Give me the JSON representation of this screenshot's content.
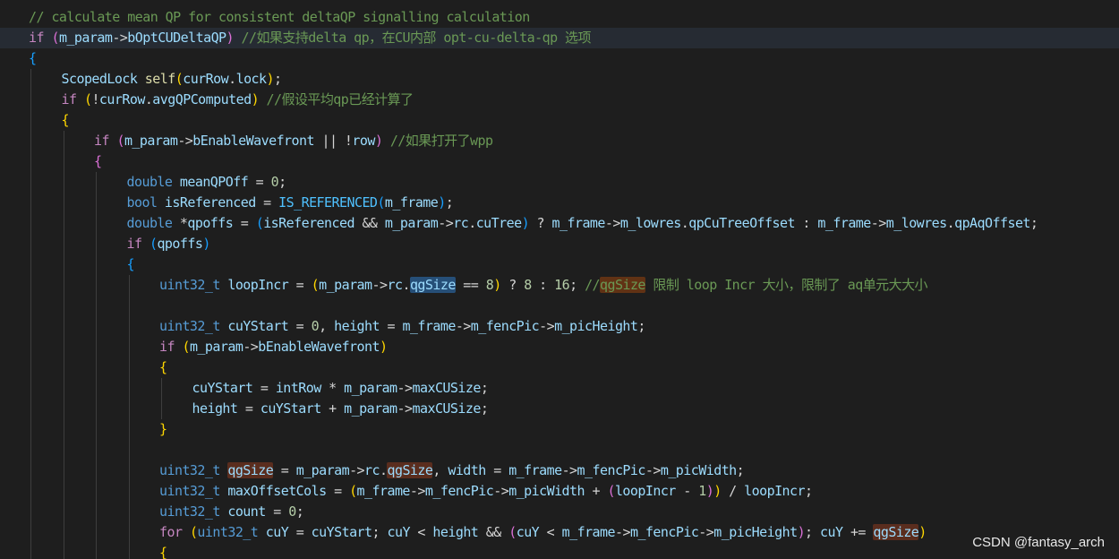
{
  "colors": {
    "background": "#1e1e1e",
    "current_line": "#262b33",
    "comment": "#6a9955",
    "keyword": "#c586c0",
    "type": "#569cd6",
    "function": "#dcdcaa",
    "variable": "#9cdcfe",
    "number": "#b5cea8",
    "bracket_level_1": "#ffd700",
    "bracket_level_2": "#da70d6",
    "bracket_level_3": "#179fff",
    "selection": "#264f78",
    "word_highlight": "#5a2d1e"
  },
  "editor": {
    "lines": [
      {
        "indent": 0,
        "tokens": [
          {
            "t": "// calculate mean QP for consistent deltaQP signalling calculation",
            "c": "cm"
          }
        ]
      },
      {
        "indent": 0,
        "current": true,
        "tokens": [
          {
            "t": "if",
            "c": "kw"
          },
          {
            "t": " ",
            "c": "pl"
          },
          {
            "t": "(",
            "c": "b2"
          },
          {
            "t": "m_param",
            "c": "var"
          },
          {
            "t": "->",
            "c": "op"
          },
          {
            "t": "bOptCUDeltaQP",
            "c": "var"
          },
          {
            "t": ")",
            "c": "b2"
          },
          {
            "t": " ",
            "c": "pl"
          },
          {
            "t": "//如果支持delta qp，在CU内部 opt-cu-delta-qp 选项",
            "c": "cm"
          }
        ]
      },
      {
        "indent": 0,
        "tokens": [
          {
            "t": "{",
            "c": "b3"
          }
        ]
      },
      {
        "indent": 1,
        "tokens": [
          {
            "t": "ScopedLock",
            "c": "var"
          },
          {
            "t": " ",
            "c": "pl"
          },
          {
            "t": "self",
            "c": "fn"
          },
          {
            "t": "(",
            "c": "b1"
          },
          {
            "t": "curRow",
            "c": "var"
          },
          {
            "t": ".",
            "c": "pl"
          },
          {
            "t": "lock",
            "c": "var"
          },
          {
            "t": ")",
            "c": "b1"
          },
          {
            "t": ";",
            "c": "pl"
          }
        ]
      },
      {
        "indent": 1,
        "tokens": [
          {
            "t": "if",
            "c": "kw"
          },
          {
            "t": " ",
            "c": "pl"
          },
          {
            "t": "(",
            "c": "b1"
          },
          {
            "t": "!",
            "c": "op"
          },
          {
            "t": "curRow",
            "c": "var"
          },
          {
            "t": ".",
            "c": "pl"
          },
          {
            "t": "avgQPComputed",
            "c": "var"
          },
          {
            "t": ")",
            "c": "b1"
          },
          {
            "t": " ",
            "c": "pl"
          },
          {
            "t": "//假设平均qp已经计算了",
            "c": "cm"
          }
        ]
      },
      {
        "indent": 1,
        "tokens": [
          {
            "t": "{",
            "c": "b1"
          }
        ]
      },
      {
        "indent": 2,
        "tokens": [
          {
            "t": "if",
            "c": "kw"
          },
          {
            "t": " ",
            "c": "pl"
          },
          {
            "t": "(",
            "c": "b2"
          },
          {
            "t": "m_param",
            "c": "var"
          },
          {
            "t": "->",
            "c": "op"
          },
          {
            "t": "bEnableWavefront",
            "c": "var"
          },
          {
            "t": " || ",
            "c": "op"
          },
          {
            "t": "!",
            "c": "op"
          },
          {
            "t": "row",
            "c": "var"
          },
          {
            "t": ")",
            "c": "b2"
          },
          {
            "t": " ",
            "c": "pl"
          },
          {
            "t": "//如果打开了wpp",
            "c": "cm"
          }
        ]
      },
      {
        "indent": 2,
        "tokens": [
          {
            "t": "{",
            "c": "b2"
          }
        ]
      },
      {
        "indent": 3,
        "tokens": [
          {
            "t": "double",
            "c": "ty"
          },
          {
            "t": " ",
            "c": "pl"
          },
          {
            "t": "meanQPOff",
            "c": "var"
          },
          {
            "t": " = ",
            "c": "op"
          },
          {
            "t": "0",
            "c": "nm"
          },
          {
            "t": ";",
            "c": "pl"
          }
        ]
      },
      {
        "indent": 3,
        "tokens": [
          {
            "t": "bool",
            "c": "ty"
          },
          {
            "t": " ",
            "c": "pl"
          },
          {
            "t": "isReferenced",
            "c": "var"
          },
          {
            "t": " = ",
            "c": "op"
          },
          {
            "t": "IS_REFERENCED",
            "c": "mc"
          },
          {
            "t": "(",
            "c": "b3"
          },
          {
            "t": "m_frame",
            "c": "var"
          },
          {
            "t": ")",
            "c": "b3"
          },
          {
            "t": ";",
            "c": "pl"
          }
        ]
      },
      {
        "indent": 3,
        "tokens": [
          {
            "t": "double",
            "c": "ty"
          },
          {
            "t": " ",
            "c": "pl"
          },
          {
            "t": "*",
            "c": "op"
          },
          {
            "t": "qpoffs",
            "c": "var"
          },
          {
            "t": " = ",
            "c": "op"
          },
          {
            "t": "(",
            "c": "b3"
          },
          {
            "t": "isReferenced",
            "c": "var"
          },
          {
            "t": " && ",
            "c": "op"
          },
          {
            "t": "m_param",
            "c": "var"
          },
          {
            "t": "->",
            "c": "op"
          },
          {
            "t": "rc",
            "c": "var"
          },
          {
            "t": ".",
            "c": "pl"
          },
          {
            "t": "cuTree",
            "c": "var"
          },
          {
            "t": ")",
            "c": "b3"
          },
          {
            "t": " ? ",
            "c": "op"
          },
          {
            "t": "m_frame",
            "c": "var"
          },
          {
            "t": "->",
            "c": "op"
          },
          {
            "t": "m_lowres",
            "c": "var"
          },
          {
            "t": ".",
            "c": "pl"
          },
          {
            "t": "qpCuTreeOffset",
            "c": "var"
          },
          {
            "t": " : ",
            "c": "op"
          },
          {
            "t": "m_frame",
            "c": "var"
          },
          {
            "t": "->",
            "c": "op"
          },
          {
            "t": "m_lowres",
            "c": "var"
          },
          {
            "t": ".",
            "c": "pl"
          },
          {
            "t": "qpAqOffset",
            "c": "var"
          },
          {
            "t": ";",
            "c": "pl"
          }
        ]
      },
      {
        "indent": 3,
        "tokens": [
          {
            "t": "if",
            "c": "kw"
          },
          {
            "t": " ",
            "c": "pl"
          },
          {
            "t": "(",
            "c": "b3"
          },
          {
            "t": "qpoffs",
            "c": "var"
          },
          {
            "t": ")",
            "c": "b3"
          }
        ]
      },
      {
        "indent": 3,
        "tokens": [
          {
            "t": "{",
            "c": "b3"
          }
        ]
      },
      {
        "indent": 4,
        "tokens": [
          {
            "t": "uint32_t",
            "c": "ty"
          },
          {
            "t": " ",
            "c": "pl"
          },
          {
            "t": "loopIncr",
            "c": "var"
          },
          {
            "t": " = ",
            "c": "op"
          },
          {
            "t": "(",
            "c": "b1"
          },
          {
            "t": "m_param",
            "c": "var"
          },
          {
            "t": "->",
            "c": "op"
          },
          {
            "t": "rc",
            "c": "var"
          },
          {
            "t": ".",
            "c": "pl"
          },
          {
            "t": "qgSize",
            "c": "var",
            "h": "sel"
          },
          {
            "t": " == ",
            "c": "op"
          },
          {
            "t": "8",
            "c": "nm"
          },
          {
            "t": ")",
            "c": "b1"
          },
          {
            "t": " ? ",
            "c": "op"
          },
          {
            "t": "8",
            "c": "nm"
          },
          {
            "t": " : ",
            "c": "op"
          },
          {
            "t": "16",
            "c": "nm"
          },
          {
            "t": "; ",
            "c": "pl"
          },
          {
            "t": "//",
            "c": "cm"
          },
          {
            "t": "qgSize",
            "c": "cm",
            "h": "find"
          },
          {
            "t": " 限制 loop Incr 大小，限制了 aq单元大大小",
            "c": "cm"
          }
        ]
      },
      {
        "indent": 4,
        "tokens": []
      },
      {
        "indent": 4,
        "tokens": [
          {
            "t": "uint32_t",
            "c": "ty"
          },
          {
            "t": " ",
            "c": "pl"
          },
          {
            "t": "cuYStart",
            "c": "var"
          },
          {
            "t": " = ",
            "c": "op"
          },
          {
            "t": "0",
            "c": "nm"
          },
          {
            "t": ", ",
            "c": "pl"
          },
          {
            "t": "height",
            "c": "var"
          },
          {
            "t": " = ",
            "c": "op"
          },
          {
            "t": "m_frame",
            "c": "var"
          },
          {
            "t": "->",
            "c": "op"
          },
          {
            "t": "m_fencPic",
            "c": "var"
          },
          {
            "t": "->",
            "c": "op"
          },
          {
            "t": "m_picHeight",
            "c": "var"
          },
          {
            "t": ";",
            "c": "pl"
          }
        ]
      },
      {
        "indent": 4,
        "tokens": [
          {
            "t": "if",
            "c": "kw"
          },
          {
            "t": " ",
            "c": "pl"
          },
          {
            "t": "(",
            "c": "b1"
          },
          {
            "t": "m_param",
            "c": "var"
          },
          {
            "t": "->",
            "c": "op"
          },
          {
            "t": "bEnableWavefront",
            "c": "var"
          },
          {
            "t": ")",
            "c": "b1"
          }
        ]
      },
      {
        "indent": 4,
        "tokens": [
          {
            "t": "{",
            "c": "b1"
          }
        ]
      },
      {
        "indent": 5,
        "tokens": [
          {
            "t": "cuYStart",
            "c": "var"
          },
          {
            "t": " = ",
            "c": "op"
          },
          {
            "t": "intRow",
            "c": "var"
          },
          {
            "t": " * ",
            "c": "op"
          },
          {
            "t": "m_param",
            "c": "var"
          },
          {
            "t": "->",
            "c": "op"
          },
          {
            "t": "maxCUSize",
            "c": "var"
          },
          {
            "t": ";",
            "c": "pl"
          }
        ]
      },
      {
        "indent": 5,
        "tokens": [
          {
            "t": "height",
            "c": "var"
          },
          {
            "t": " = ",
            "c": "op"
          },
          {
            "t": "cuYStart",
            "c": "var"
          },
          {
            "t": " + ",
            "c": "op"
          },
          {
            "t": "m_param",
            "c": "var"
          },
          {
            "t": "->",
            "c": "op"
          },
          {
            "t": "maxCUSize",
            "c": "var"
          },
          {
            "t": ";",
            "c": "pl"
          }
        ]
      },
      {
        "indent": 4,
        "tokens": [
          {
            "t": "}",
            "c": "b1"
          }
        ]
      },
      {
        "indent": 4,
        "tokens": []
      },
      {
        "indent": 4,
        "tokens": [
          {
            "t": "uint32_t",
            "c": "ty"
          },
          {
            "t": " ",
            "c": "pl"
          },
          {
            "t": "qgSize",
            "c": "var",
            "h": "word"
          },
          {
            "t": " = ",
            "c": "op"
          },
          {
            "t": "m_param",
            "c": "var"
          },
          {
            "t": "->",
            "c": "op"
          },
          {
            "t": "rc",
            "c": "var"
          },
          {
            "t": ".",
            "c": "pl"
          },
          {
            "t": "qgSize",
            "c": "var",
            "h": "word"
          },
          {
            "t": ", ",
            "c": "pl"
          },
          {
            "t": "width",
            "c": "var"
          },
          {
            "t": " = ",
            "c": "op"
          },
          {
            "t": "m_frame",
            "c": "var"
          },
          {
            "t": "->",
            "c": "op"
          },
          {
            "t": "m_fencPic",
            "c": "var"
          },
          {
            "t": "->",
            "c": "op"
          },
          {
            "t": "m_picWidth",
            "c": "var"
          },
          {
            "t": ";",
            "c": "pl"
          }
        ]
      },
      {
        "indent": 4,
        "tokens": [
          {
            "t": "uint32_t",
            "c": "ty"
          },
          {
            "t": " ",
            "c": "pl"
          },
          {
            "t": "maxOffsetCols",
            "c": "var"
          },
          {
            "t": " = ",
            "c": "op"
          },
          {
            "t": "(",
            "c": "b1"
          },
          {
            "t": "m_frame",
            "c": "var"
          },
          {
            "t": "->",
            "c": "op"
          },
          {
            "t": "m_fencPic",
            "c": "var"
          },
          {
            "t": "->",
            "c": "op"
          },
          {
            "t": "m_picWidth",
            "c": "var"
          },
          {
            "t": " + ",
            "c": "op"
          },
          {
            "t": "(",
            "c": "b2"
          },
          {
            "t": "loopIncr",
            "c": "var"
          },
          {
            "t": " - ",
            "c": "op"
          },
          {
            "t": "1",
            "c": "nm"
          },
          {
            "t": ")",
            "c": "b2"
          },
          {
            "t": ")",
            "c": "b1"
          },
          {
            "t": " / ",
            "c": "op"
          },
          {
            "t": "loopIncr",
            "c": "var"
          },
          {
            "t": ";",
            "c": "pl"
          }
        ]
      },
      {
        "indent": 4,
        "tokens": [
          {
            "t": "uint32_t",
            "c": "ty"
          },
          {
            "t": " ",
            "c": "pl"
          },
          {
            "t": "count",
            "c": "var"
          },
          {
            "t": " = ",
            "c": "op"
          },
          {
            "t": "0",
            "c": "nm"
          },
          {
            "t": ";",
            "c": "pl"
          }
        ]
      },
      {
        "indent": 4,
        "tokens": [
          {
            "t": "for",
            "c": "kw"
          },
          {
            "t": " ",
            "c": "pl"
          },
          {
            "t": "(",
            "c": "b1"
          },
          {
            "t": "uint32_t",
            "c": "ty"
          },
          {
            "t": " ",
            "c": "pl"
          },
          {
            "t": "cuY",
            "c": "var"
          },
          {
            "t": " = ",
            "c": "op"
          },
          {
            "t": "cuYStart",
            "c": "var"
          },
          {
            "t": "; ",
            "c": "pl"
          },
          {
            "t": "cuY",
            "c": "var"
          },
          {
            "t": " < ",
            "c": "op"
          },
          {
            "t": "height",
            "c": "var"
          },
          {
            "t": " && ",
            "c": "op"
          },
          {
            "t": "(",
            "c": "b2"
          },
          {
            "t": "cuY",
            "c": "var"
          },
          {
            "t": " < ",
            "c": "op"
          },
          {
            "t": "m_frame",
            "c": "var"
          },
          {
            "t": "->",
            "c": "op"
          },
          {
            "t": "m_fencPic",
            "c": "var"
          },
          {
            "t": "->",
            "c": "op"
          },
          {
            "t": "m_picHeight",
            "c": "var"
          },
          {
            "t": ")",
            "c": "b2"
          },
          {
            "t": "; ",
            "c": "pl"
          },
          {
            "t": "cuY",
            "c": "var"
          },
          {
            "t": " += ",
            "c": "op"
          },
          {
            "t": "qgSize",
            "c": "var",
            "h": "word"
          },
          {
            "t": ")",
            "c": "b1"
          }
        ]
      },
      {
        "indent": 4,
        "tokens": [
          {
            "t": "{",
            "c": "b1"
          }
        ]
      }
    ]
  },
  "watermark": "CSDN @fantasy_arch"
}
